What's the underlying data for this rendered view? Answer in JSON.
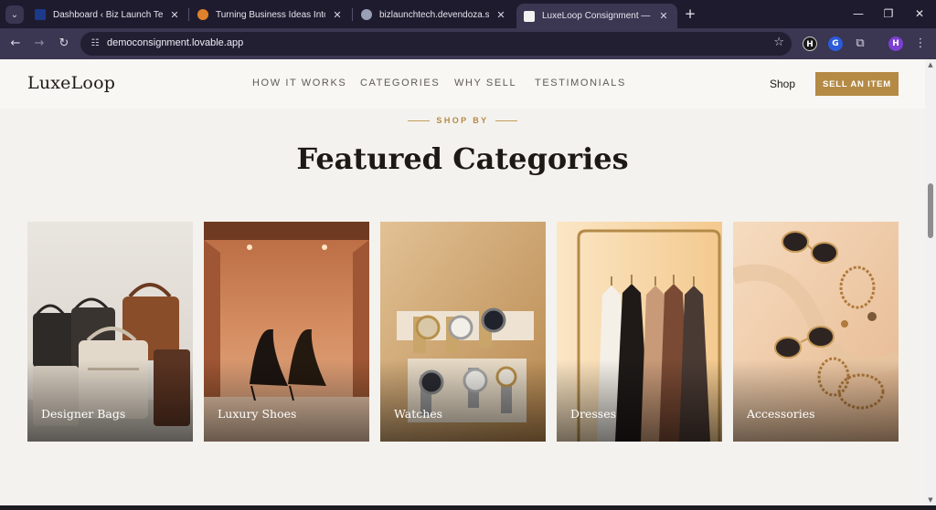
{
  "browser": {
    "tabs": [
      {
        "label": "Dashboard ‹ Biz Launch Tech —",
        "favicon_color": "#1b3a8a",
        "active": false
      },
      {
        "label": "Turning Business Ideas Into Mill",
        "favicon_color": "#e0822b",
        "active": false
      },
      {
        "label": "bizlaunchtech.devendoza.shop",
        "favicon_color": "#9aa0b5",
        "active": false
      },
      {
        "label": "LuxeLoop Consignment — Sell",
        "favicon_color": "#f2f2f2",
        "active": true
      }
    ],
    "tab_close_glyph": "✕",
    "new_tab_glyph": "+",
    "url": "democonsignment.lovable.app",
    "extensions": [
      {
        "name": "hootsuite-extension-icon",
        "letter": "H",
        "color": "#1a1a1a"
      },
      {
        "name": "blue-extension-icon",
        "letter": "G",
        "color": "#2c5bd8"
      },
      {
        "name": "profile-avatar",
        "letter": "H",
        "color": "#7b3fd1"
      }
    ]
  },
  "site": {
    "brand": "LuxeLoop",
    "nav": [
      {
        "label": "HOW IT WORKS"
      },
      {
        "label": "CATEGORIES"
      },
      {
        "label": "WHY SELL"
      },
      {
        "label": "TESTIMONIALS"
      }
    ],
    "shop_label": "Shop",
    "sell_button": "SELL AN ITEM",
    "accent_color": "#b48a45"
  },
  "section": {
    "eyebrow": "SHOP BY",
    "title": "Featured Categories"
  },
  "categories": [
    {
      "label": "Designer Bags"
    },
    {
      "label": "Luxury Shoes"
    },
    {
      "label": "Watches"
    },
    {
      "label": "Dresses"
    },
    {
      "label": "Accessories"
    }
  ]
}
